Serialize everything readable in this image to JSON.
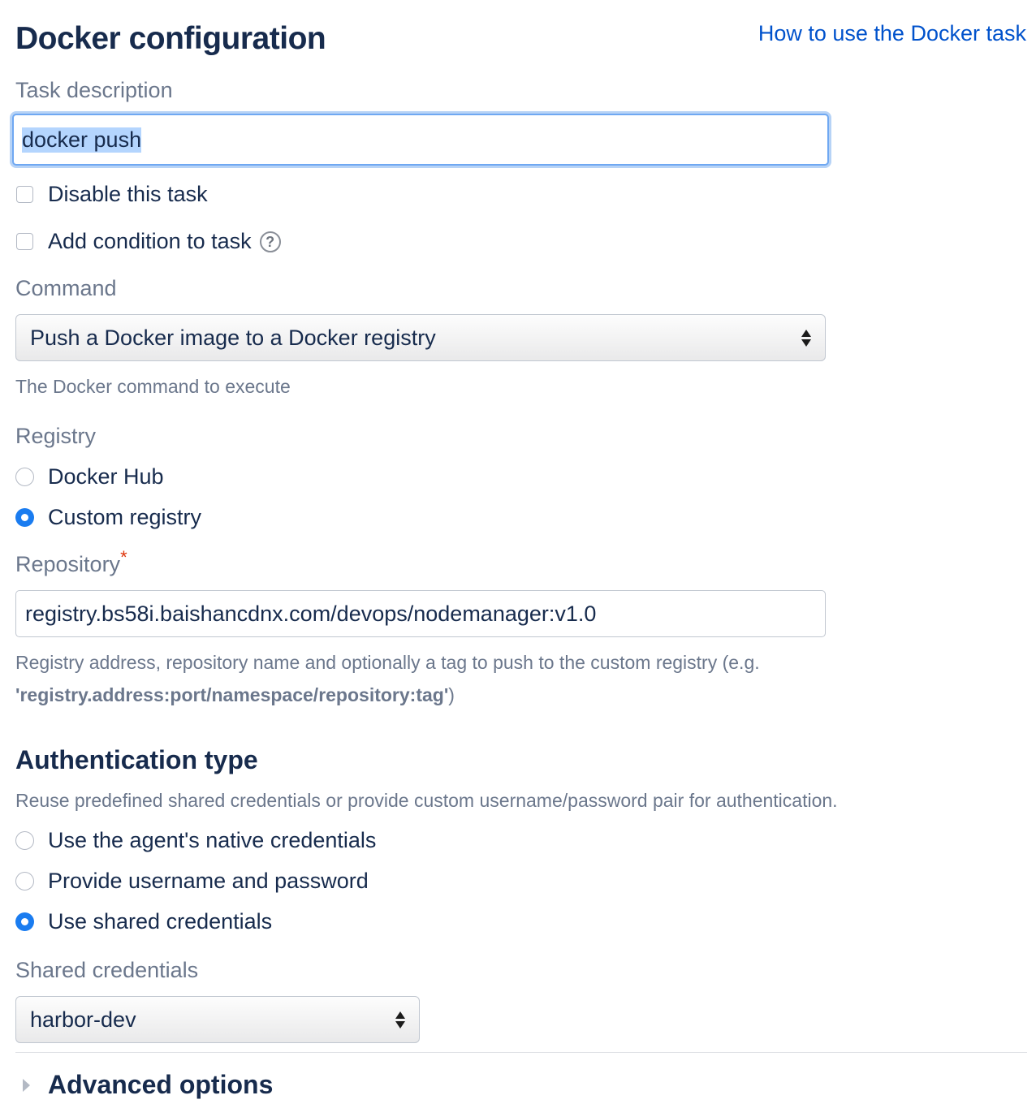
{
  "header": {
    "title": "Docker configuration",
    "help_link": "How to use the Docker task"
  },
  "task_description": {
    "label": "Task description",
    "value": "docker push"
  },
  "disable_task": {
    "label": "Disable this task",
    "checked": false
  },
  "add_condition": {
    "label": "Add condition to task",
    "checked": false,
    "help_icon": "?"
  },
  "command": {
    "label": "Command",
    "selected": "Push a Docker image to a Docker registry",
    "description": "The Docker command to execute"
  },
  "registry": {
    "label": "Registry",
    "options": [
      {
        "label": "Docker Hub",
        "checked": false
      },
      {
        "label": "Custom registry",
        "checked": true
      }
    ]
  },
  "repository": {
    "label": "Repository",
    "required_mark": "*",
    "value": "registry.bs58i.baishancdnx.com/devops/nodemanager:v1.0",
    "description_line1": "Registry address, repository name and optionally a tag to push to the custom registry (e.g.",
    "description_example": "'registry.address:port/namespace/repository:tag'",
    "description_end": ")"
  },
  "authentication": {
    "heading": "Authentication type",
    "description": "Reuse predefined shared credentials or provide custom username/password pair for authentication.",
    "options": [
      {
        "label": "Use the agent's native credentials",
        "checked": false
      },
      {
        "label": "Provide username and password",
        "checked": false
      },
      {
        "label": "Use shared credentials",
        "checked": true
      }
    ]
  },
  "shared_credentials": {
    "label": "Shared credentials",
    "selected": "harbor-dev"
  },
  "advanced_options": {
    "label": "Advanced options",
    "expanded": false
  },
  "colors": {
    "accent": "#1a7cf0",
    "link": "#0052cc",
    "label": "#6b778c",
    "text": "#172b4d",
    "required": "#de350b"
  }
}
